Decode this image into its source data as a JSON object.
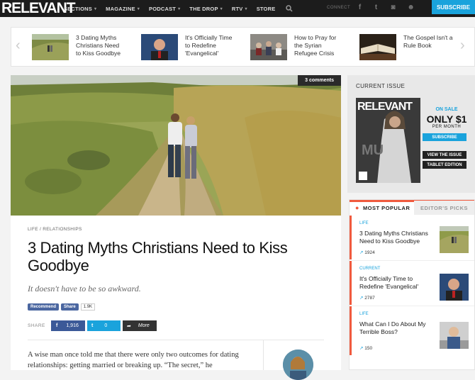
{
  "nav": {
    "logo": "RELEVANT",
    "items": [
      "SECTIONS",
      "MAGAZINE",
      "PODCAST",
      "THE DROP",
      "RTV",
      "STORE"
    ],
    "connect": "CONNECT",
    "subscribe": "SUBSCRIBE"
  },
  "carousel": [
    {
      "title": "3 Dating Myths Christians Need to Kiss Goodbye"
    },
    {
      "title": "It's Officially Time to Redefine 'Evangelical'"
    },
    {
      "title": "How to Pray for the Syrian Refugee Crisis"
    },
    {
      "title": "The Gospel Isn't a Rule Book"
    }
  ],
  "article": {
    "comments": "3 comments",
    "crumb": "LIFE / RELATIONSHIPS",
    "title": "3 Dating Myths Christians Need to Kiss Goodbye",
    "subtitle": "It doesn't have to be so awkward.",
    "fb_recommend": "Recommend",
    "fb_share": "Share",
    "fb_count": "1.9K",
    "share_label": "SHARE",
    "fb_shares": "1,916",
    "tw_shares": "0",
    "more": "More",
    "body": "A wise man once told me that there were only two outcomes for dating relationships: getting married or breaking up. “The secret,” he"
  },
  "issue": {
    "label": "CURRENT ISSUE",
    "cover_logo": "RELEVANT",
    "on_sale": "ON SALE",
    "price": "ONLY $1",
    "per_month": "PER MONTH",
    "subscribe": "SUBSCRIBE",
    "view_issue": "VIEW THE ISSUE",
    "tablet": "TABLET EDITION"
  },
  "popular": {
    "tab_popular": "MOST POPULAR",
    "tab_picks": "EDITOR'S PICKS",
    "items": [
      {
        "cat": "LIFE",
        "title": "3 Dating Myths Christians Need to Kiss Goodbye",
        "count": "1924"
      },
      {
        "cat": "CURRENT",
        "title": "It's Officially Time to Redefine 'Evangelical'",
        "count": "2787"
      },
      {
        "cat": "LIFE",
        "title": "What Can I Do About My Terrible Boss?",
        "count": "150"
      }
    ]
  },
  "colors": {
    "accent": "#1aa3dc",
    "popular": "#f05a3e",
    "facebook": "#3b5998"
  }
}
